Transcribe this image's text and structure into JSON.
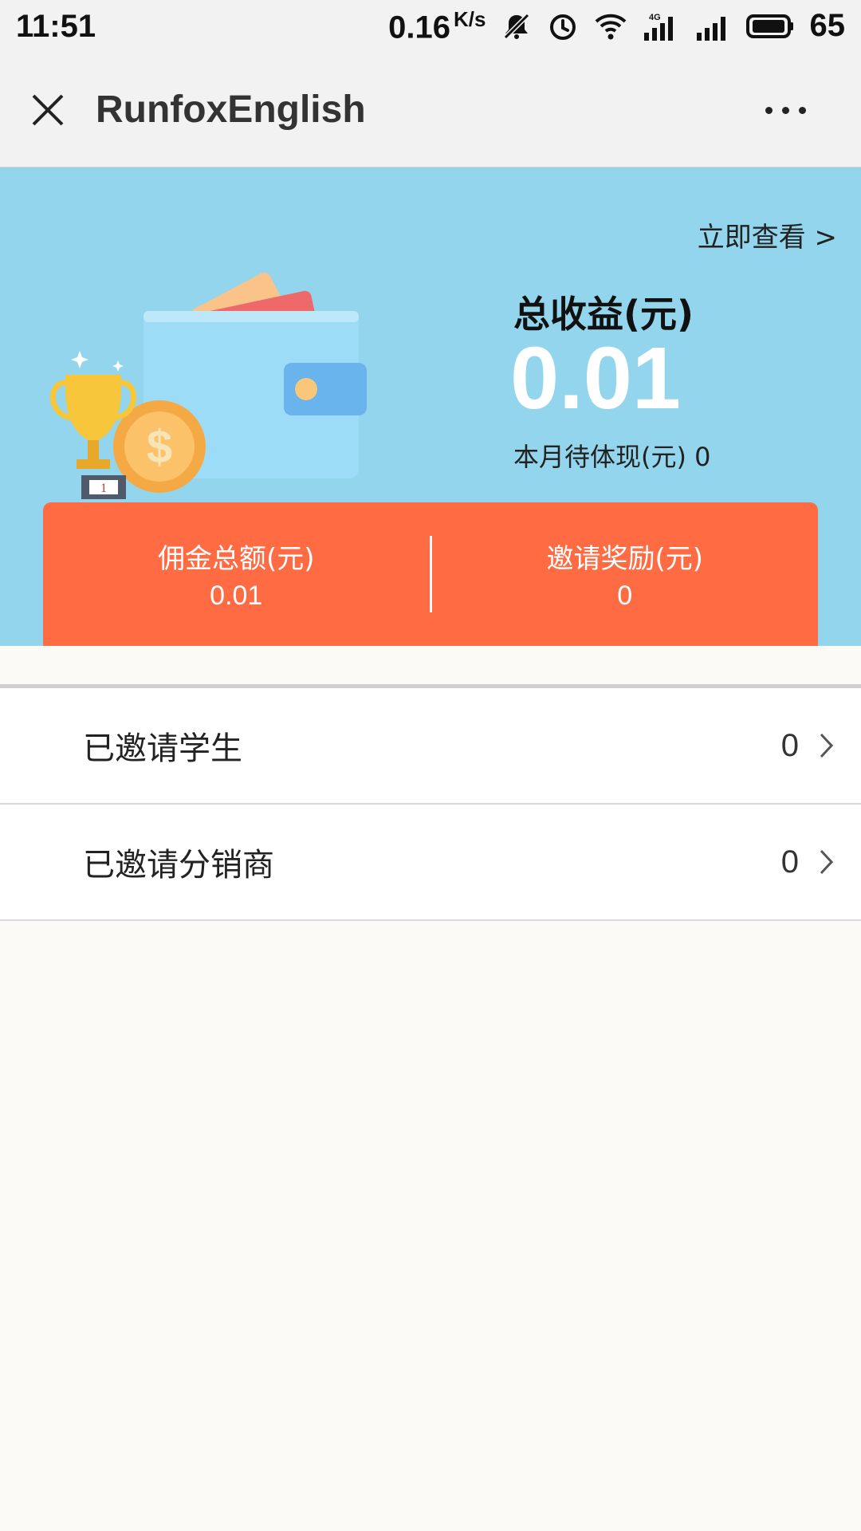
{
  "status_bar": {
    "time": "11:51",
    "speed": "0.16",
    "speed_unit": "K/s",
    "network_badge": "4G",
    "battery": "65",
    "icons": [
      "mute-icon",
      "alarm-icon",
      "wifi-icon",
      "signal-icon",
      "signal-icon",
      "battery-icon"
    ]
  },
  "title_bar": {
    "title": "RunfoxEnglish",
    "close_icon": "close-icon",
    "more_icon": "more-icon"
  },
  "banner": {
    "view_now": "立即查看 >",
    "total_label": "总收益(元)",
    "total_value": "0.01",
    "monthly_pending": "本月待体现(元) 0",
    "trophy_label": "1",
    "stats": [
      {
        "label": "佣金总额(元)",
        "value": "0.01"
      },
      {
        "label": "邀请奖励(元)",
        "value": "0"
      }
    ]
  },
  "list": {
    "items": [
      {
        "label": "已邀请学生",
        "count": "0"
      },
      {
        "label": "已邀请分销商",
        "count": "0"
      }
    ]
  },
  "colors": {
    "banner_bg": "#92d5ec",
    "stats_card_bg": "#ff6c44",
    "page_bg": "#fbfaf6"
  }
}
